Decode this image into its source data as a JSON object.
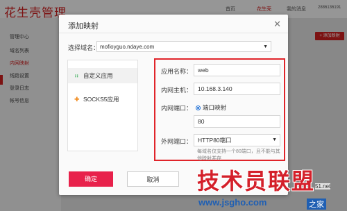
{
  "app": {
    "logo": "花生壳管理",
    "nav": [
      "首页",
      "花生壳",
      "我的消息",
      "2886136191"
    ],
    "sidebar": [
      "管理中心",
      "域名列表",
      "内网映射",
      "线路设置",
      "登录日志",
      "帐号信息"
    ],
    "add_button": "+ 添加映射"
  },
  "dialog": {
    "title": "添加映射",
    "close_icon": "close-icon",
    "domain_label": "选择域名：",
    "domain_value": "mofioyguo.ndaye.com",
    "types": [
      {
        "label": "自定义应用",
        "icon": "grid-icon",
        "selected": true
      },
      {
        "label": "SOCKS5应用",
        "icon": "plus-icon",
        "selected": false
      }
    ],
    "app_name_label": "应用名称：",
    "app_name_value": "web",
    "host_label": "内网主机：",
    "host_value": "10.168.3.140",
    "inner_port_label": "内网端口：",
    "port_mapping_radio": "端口映射",
    "inner_port_value": "80",
    "outer_port_label": "外网端口：",
    "outer_port_value": "HTTP80端口",
    "hint": "每域名仅支持一个80端口，且不能与其他映射并存",
    "confirm": "确定",
    "cancel": "取消"
  },
  "watermark": {
    "text": "技术员联盟",
    "url": "www.jsgho.com",
    "site": "之家",
    "tag": "51.net"
  },
  "colors": {
    "accent": "#e8214b",
    "highlight_border": "#e0242a",
    "radio": "#1e6fd6"
  }
}
